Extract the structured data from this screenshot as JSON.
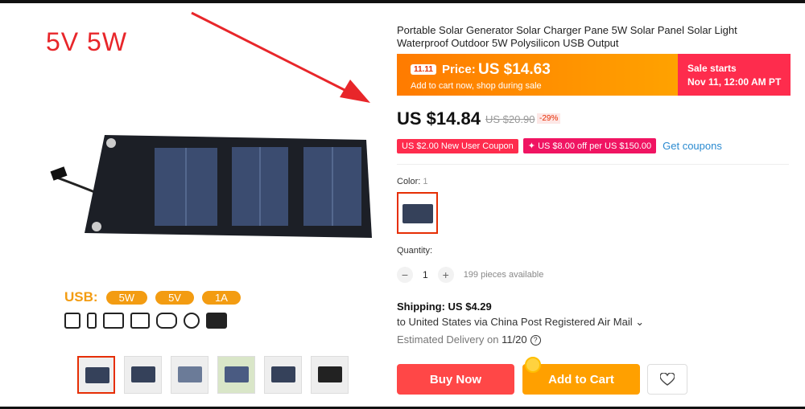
{
  "gallery": {
    "hero_label": "5V 5W",
    "usb_label": "USB:",
    "usb_specs": [
      "5W",
      "5V",
      "1A"
    ],
    "device_icons": [
      "tablet-icon",
      "phone-icon",
      "camera-icon",
      "speaker-icon",
      "mp3-player-icon",
      "disc-icon",
      "camcorder-icon"
    ],
    "thumbnail_count": 6
  },
  "product": {
    "title": "Portable Solar Generator Solar Charger Pane 5W Solar Panel Solar Light Waterproof Outdoor 5W Polysilicon USB Output",
    "promo": {
      "badge": "11.11",
      "price_label": "Price:",
      "price_value": "US $14.63",
      "subtitle": "Add to cart now, shop during sale",
      "sale_title": "Sale starts",
      "sale_time": "Nov 11, 12:00 AM PT"
    },
    "price": "US $14.84",
    "old_price": "US $20.90",
    "discount": "-29%",
    "coupons": [
      "US $2.00 New User Coupon",
      "✦ US $8.00 off per US $150.00"
    ],
    "get_coupons": "Get coupons",
    "color_label": "Color:",
    "color_count": "1",
    "quantity_label": "Quantity:",
    "quantity_value": "1",
    "available": "199 pieces available",
    "shipping": "Shipping: US $4.29",
    "ship_dest": "to United States via China Post Registered Air Mail ⌄",
    "delivery_prefix": "Estimated Delivery on",
    "delivery_date": "11/20",
    "buy_now": "Buy Now",
    "add_to_cart": "Add to Cart"
  },
  "colors": {
    "accent": "#e62e04",
    "promo_orange": "#ff7b00",
    "sale_red": "#fe2c4d",
    "buy": "#ff4747",
    "cart": "#ffa000",
    "link": "#2a8ad0"
  }
}
